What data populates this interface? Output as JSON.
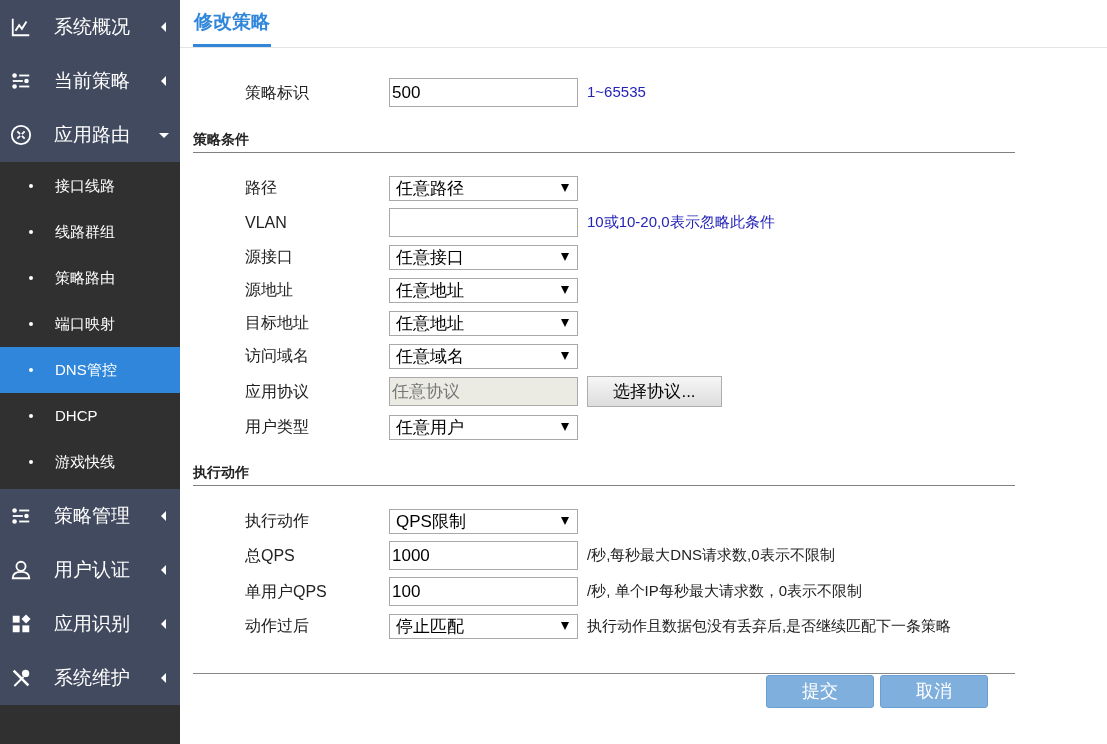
{
  "sidebar": {
    "items": [
      {
        "label": "系统概况",
        "expanded": false
      },
      {
        "label": "当前策略",
        "expanded": false
      },
      {
        "label": "应用路由",
        "expanded": true,
        "children": [
          {
            "label": "接口线路",
            "selected": false
          },
          {
            "label": "线路群组",
            "selected": false
          },
          {
            "label": "策略路由",
            "selected": false
          },
          {
            "label": "端口映射",
            "selected": false
          },
          {
            "label": "DNS管控",
            "selected": true
          },
          {
            "label": "DHCP",
            "selected": false
          },
          {
            "label": "游戏快线",
            "selected": false
          }
        ]
      },
      {
        "label": "策略管理",
        "expanded": false
      },
      {
        "label": "用户认证",
        "expanded": false
      },
      {
        "label": "应用识别",
        "expanded": false
      },
      {
        "label": "系统维护",
        "expanded": false
      }
    ]
  },
  "page_tab": {
    "label": "修改策略",
    "selected": true
  },
  "sections": [
    {
      "rows": [
        {
          "label": "策略标识",
          "kind": "input",
          "value": "500",
          "hint": {
            "text": "1~65535",
            "kind": "info"
          }
        }
      ]
    },
    {
      "title": "策略条件",
      "rows": [
        {
          "label": "路径",
          "kind": "select",
          "value": "任意路径"
        },
        {
          "label": "VLAN",
          "kind": "input",
          "value": "",
          "hint": {
            "text": "10或10-20,0表示忽略此条件",
            "kind": "info"
          }
        },
        {
          "label": "源接口",
          "kind": "select",
          "value": "任意接口"
        },
        {
          "label": "源地址",
          "kind": "select",
          "value": "任意地址"
        },
        {
          "label": "目标地址",
          "kind": "select",
          "value": "任意地址"
        },
        {
          "label": "访问域名",
          "kind": "select",
          "value": "任意域名"
        },
        {
          "label": "应用协议",
          "kind": "readonly",
          "value": "任意协议",
          "button": "选择协议..."
        },
        {
          "label": "用户类型",
          "kind": "select",
          "value": "任意用户"
        }
      ]
    },
    {
      "title": "执行动作",
      "rows": [
        {
          "label": "执行动作",
          "kind": "select",
          "value": "QPS限制"
        },
        {
          "label": "总QPS",
          "kind": "input",
          "value": "1000",
          "hint": {
            "text": "/秒,每秒最大DNS请求数,0表示不限制",
            "kind": "note"
          }
        },
        {
          "label": "单用户QPS",
          "kind": "input",
          "value": "100",
          "hint": {
            "text": "/秒, 单个IP每秒最大请求数，0表示不限制",
            "kind": "note"
          }
        },
        {
          "label": "动作过后",
          "kind": "select",
          "value": "停止匹配",
          "hint": {
            "text": "执行动作且数据包没有丢弃后,是否继续匹配下一条策略",
            "kind": "note"
          }
        }
      ]
    }
  ],
  "buttons": [
    "提交",
    "取消"
  ]
}
